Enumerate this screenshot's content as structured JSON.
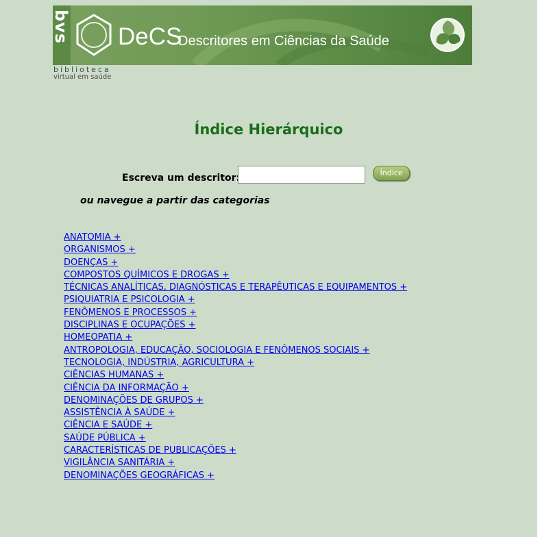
{
  "banner": {
    "bvs": "bvs",
    "decs": "DeCS",
    "subtitle": "Descritores em Ciências da Saúde",
    "caption_line1": "biblioteca",
    "caption_line2": "virtual em saúde"
  },
  "title": "Índice Hierárquico",
  "search": {
    "label": "Escreva um descritor:",
    "value": "",
    "button_label": "Índice"
  },
  "browse_note": "ou navegue a partir das categorias",
  "categories": [
    "ANATOMIA +",
    "ORGANISMOS +",
    "DOENÇAS +",
    "COMPOSTOS QUÍMICOS E DROGAS +",
    "TÉCNICAS ANALÍTICAS, DIAGNÓSTICAS E TERAPÊUTICAS E EQUIPAMENTOS +",
    "PSIQUIATRIA E PSICOLOGIA +",
    "FENÔMENOS E PROCESSOS +",
    "DISCIPLINAS E OCUPAÇÕES +",
    "HOMEOPATIA +",
    "ANTROPOLOGIA, EDUCAÇÃO, SOCIOLOGIA E FENÔMENOS SOCIAIS +",
    "TECNOLOGIA, INDÚSTRIA, AGRICULTURA +",
    "CIÊNCIAS HUMANAS +",
    "CIÊNCIA DA INFORMAÇÃO +",
    "DENOMINAÇÕES DE GRUPOS +",
    "ASSISTÊNCIA À SAÚDE +",
    "CIÊNCIA E SAÚDE +",
    "SAÚDE PÚBLICA +",
    "CARACTERÍSTICAS DE PUBLICAÇÕES +",
    "VIGILÂNCIA SANITÁRIA +",
    "DENOMINAÇÕES GEOGRÁFICAS +"
  ],
  "colors": {
    "page_background": "#ccdcc9",
    "title": "#1a6e1a",
    "link": "#0000ee",
    "banner": "#6f9a55"
  }
}
